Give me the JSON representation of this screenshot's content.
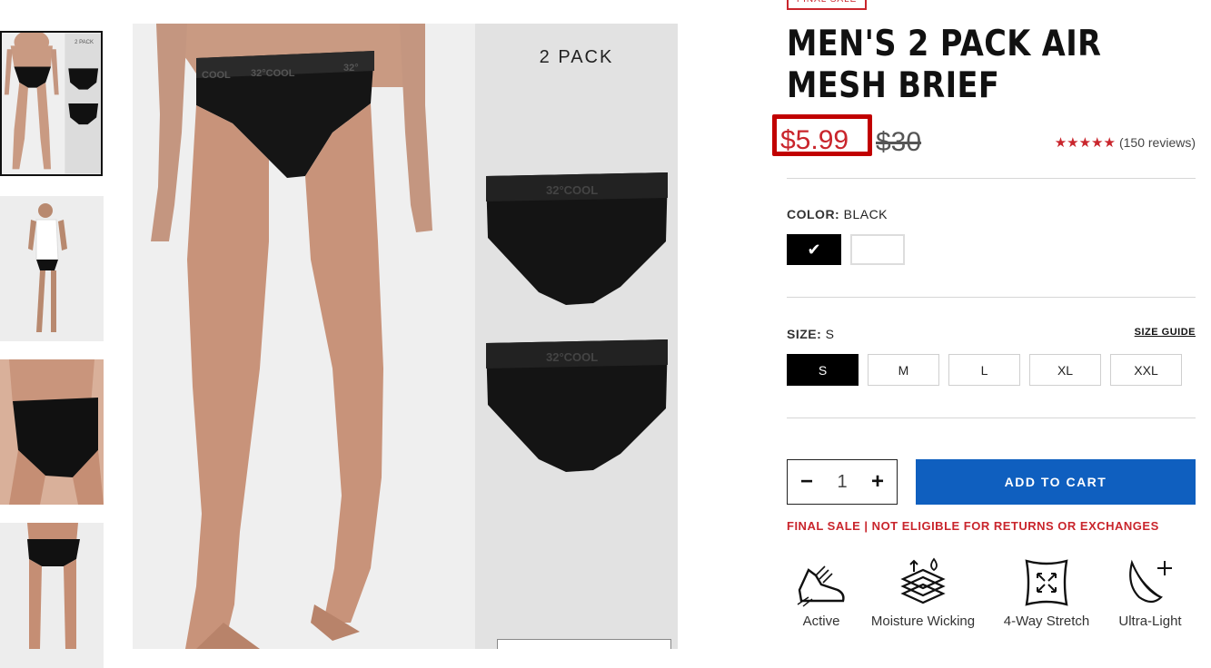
{
  "gallery": {
    "thumb1_pack_label": "2 PACK",
    "hero_pack_label": "2 PACK"
  },
  "product": {
    "badge": "FINAL SALE",
    "title": "MEN'S 2 PACK AIR MESH BRIEF",
    "sale_price": "$5.99",
    "original_price": "$30",
    "rating_stars": 5,
    "reviews": "(150 reviews)",
    "color_label": "COLOR:",
    "color_value": "BLACK",
    "colors": [
      "black",
      "white"
    ],
    "size_label": "SIZE:",
    "size_value": "S",
    "size_guide": "SIZE GUIDE",
    "sizes": [
      "S",
      "M",
      "L",
      "XL",
      "XXL"
    ],
    "quantity": "1",
    "qty_minus": "−",
    "qty_plus": "+",
    "add_to_cart": "ADD TO CART",
    "final_sale_note": "FINAL SALE | NOT ELIGIBLE FOR RETURNS OR EXCHANGES",
    "features": [
      {
        "label": "Active",
        "icon": "shoe-icon"
      },
      {
        "label": "Moisture Wicking",
        "icon": "moisture-wicking-icon"
      },
      {
        "label": "4-Way Stretch",
        "icon": "stretch-icon"
      },
      {
        "label": "Ultra-Light",
        "icon": "feather-icon"
      }
    ]
  },
  "colors": {
    "sale_red": "#c9252c",
    "highlight_border": "#c10000",
    "cart_blue": "#0f5fbf"
  }
}
